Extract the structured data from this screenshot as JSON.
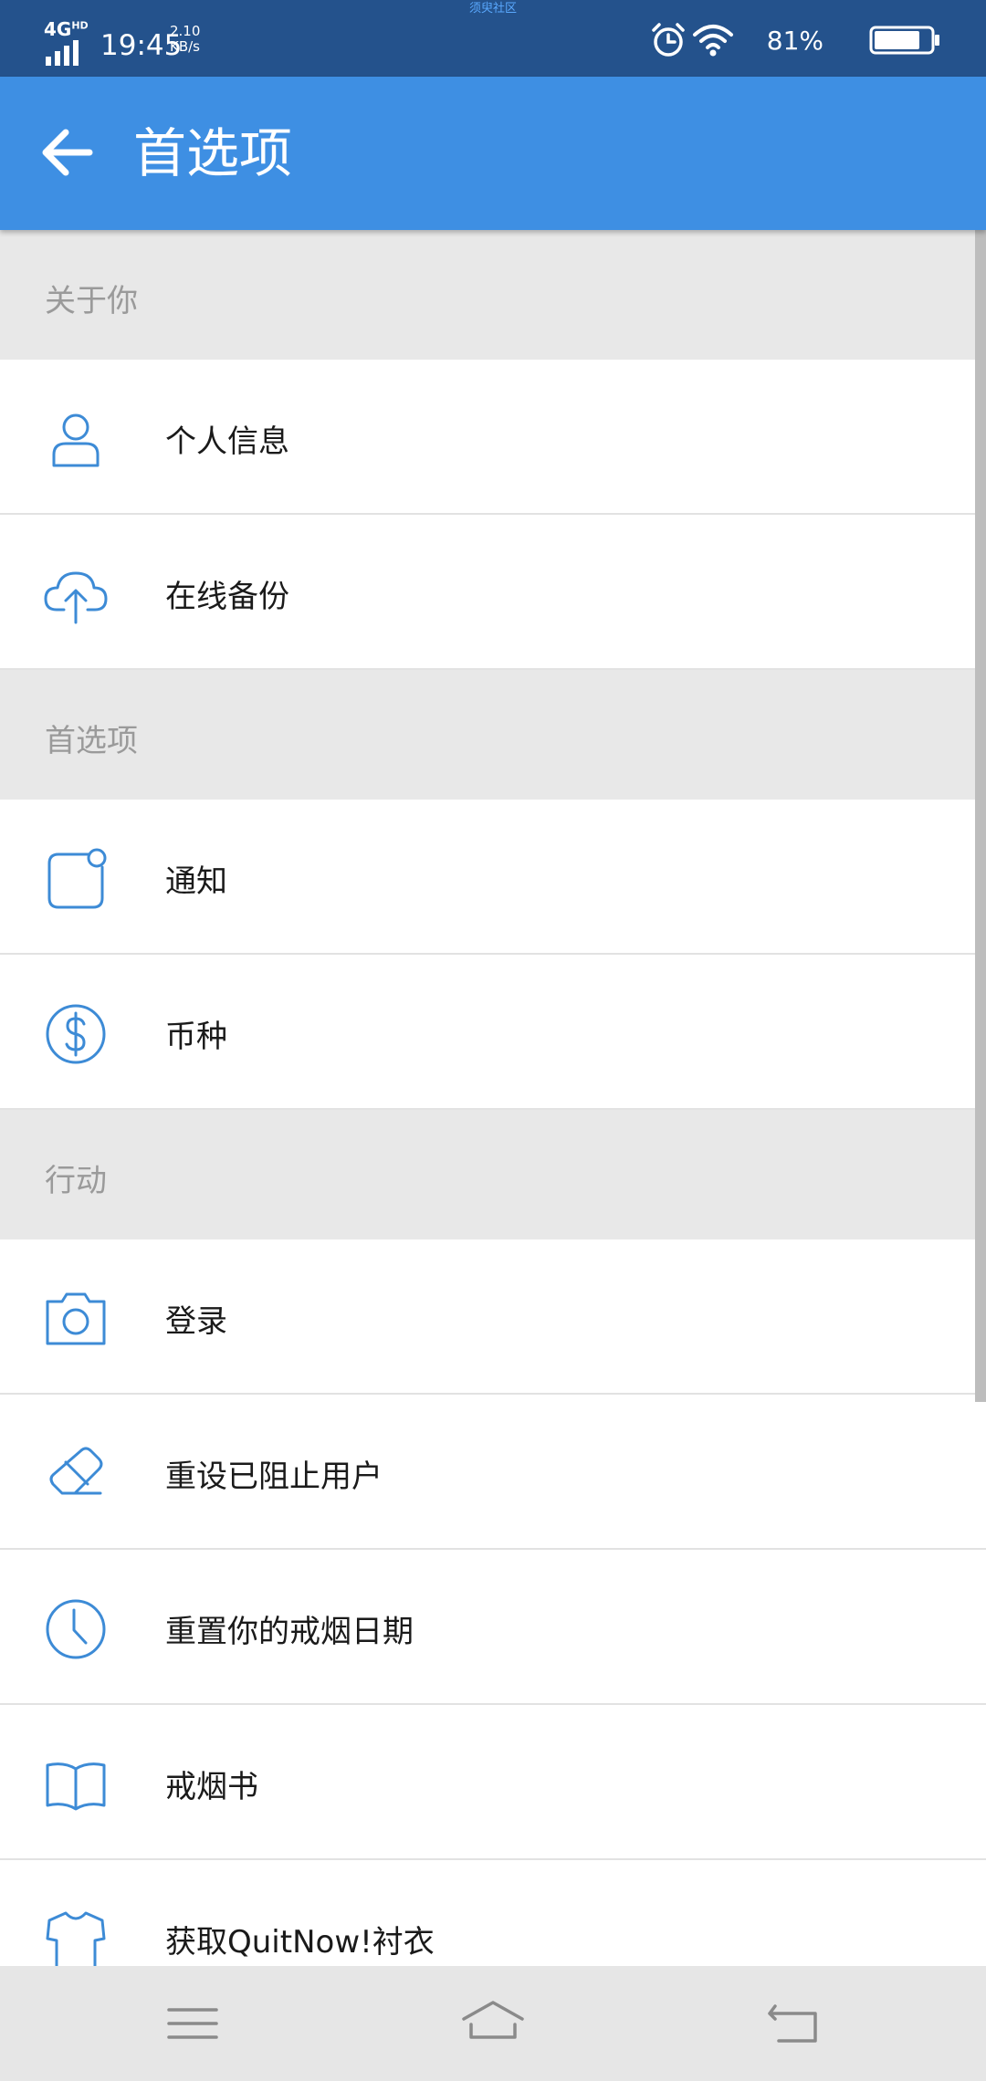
{
  "status_bar": {
    "network": "4G",
    "network_badge": "HD",
    "time": "19:45",
    "speed_value": "2.10",
    "speed_unit": "KB/s",
    "banner": "须臾社区",
    "battery": "81%",
    "battery_level": 0.81
  },
  "app_bar": {
    "title": "首选项"
  },
  "sections": [
    {
      "header": "关于你",
      "items": [
        {
          "label": "个人信息",
          "icon": "person-icon"
        },
        {
          "label": "在线备份",
          "icon": "cloud-upload-icon"
        }
      ]
    },
    {
      "header": "首选项",
      "items": [
        {
          "label": "通知",
          "icon": "notification-icon"
        },
        {
          "label": "币种",
          "icon": "dollar-icon"
        }
      ]
    },
    {
      "header": "行动",
      "items": [
        {
          "label": "登录",
          "icon": "camera-icon"
        },
        {
          "label": "重设已阻止用户",
          "icon": "eraser-icon"
        },
        {
          "label": "重置你的戒烟日期",
          "icon": "clock-icon"
        },
        {
          "label": "戒烟书",
          "icon": "book-icon"
        },
        {
          "label": "获取QuitNow!衬衣",
          "icon": "shirt-icon"
        }
      ]
    }
  ],
  "colors": {
    "status_bar": "#24528c",
    "app_bar": "#3e8fe3",
    "icon": "#3d8bd6",
    "section_bg": "#e8e8e8",
    "nav_bar": "#e6e6e6"
  }
}
